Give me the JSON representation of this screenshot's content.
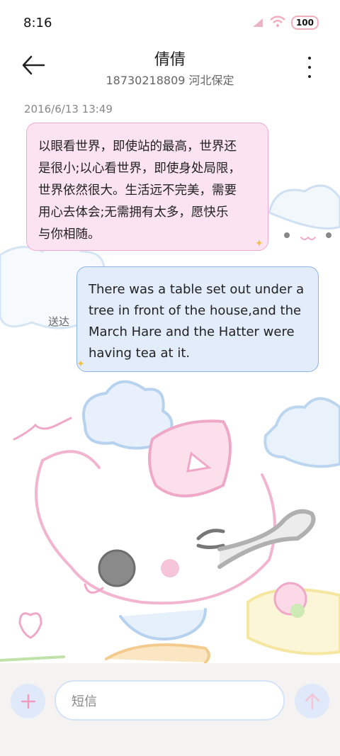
{
  "status_bar": {
    "time": "8:16",
    "battery": "100",
    "icons": [
      "signal-icon",
      "wifi-icon",
      "battery-icon"
    ]
  },
  "header": {
    "contact_name": "倩倩",
    "contact_info": "18730218809 河北保定",
    "icons": [
      "back-arrow-icon",
      "more-vertical-icon"
    ]
  },
  "conversation": {
    "timestamp": "2016/6/13 13:49",
    "messages": [
      {
        "direction": "incoming",
        "lines": [
          "以眼看世界，即使站的最高，世界还",
          "是很小;以心看世界，即使身处局限，",
          "世界依然很大。生活远不完美，需要",
          "用心去体会;无需拥有太多，愿快乐",
          "与你相随。"
        ]
      },
      {
        "direction": "outgoing",
        "status": "送达",
        "lines": [
          "There was a table set out under a",
          "tree in front of the house,and the",
          "March Hare and the Hatter were",
          "having tea at it."
        ]
      }
    ]
  },
  "composer": {
    "placeholder": "短信",
    "icons": [
      "plus-icon",
      "send-arrow-icon"
    ]
  },
  "colors": {
    "incoming_bubble": "#fbe3f1",
    "incoming_border": "#f2a8cf",
    "outgoing_bubble": "#e2ecfa",
    "outgoing_border": "#8db3e6",
    "accent_pink": "#f0aebd",
    "composer_bg": "#f4f3f2"
  }
}
